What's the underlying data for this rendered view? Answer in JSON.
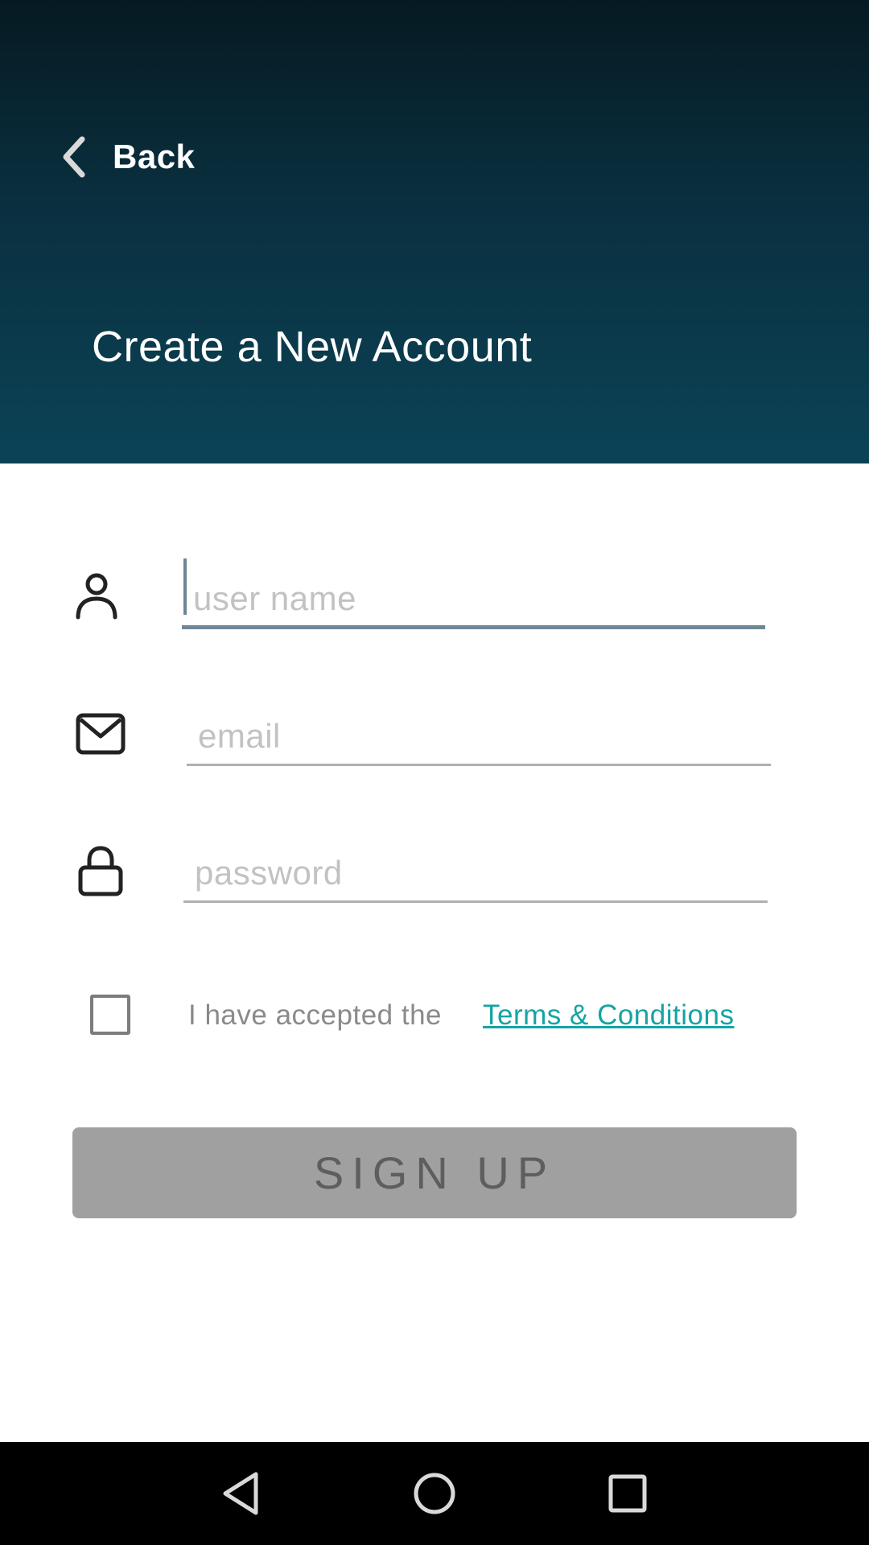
{
  "header": {
    "back_label": "Back",
    "title": "Create a New Account"
  },
  "form": {
    "username": {
      "placeholder": "user name",
      "value": "",
      "icon": "user-icon"
    },
    "email": {
      "placeholder": "email",
      "value": "",
      "icon": "envelope-icon"
    },
    "password": {
      "placeholder": "password",
      "value": "",
      "icon": "lock-icon"
    }
  },
  "terms": {
    "checked": false,
    "text": "I have accepted the",
    "link": "Terms & Conditions"
  },
  "signup_label": "SIGN UP",
  "colors": {
    "header_top": "#061a22",
    "header_bottom": "#0b4356",
    "link": "#16a3a3",
    "button_disabled": "#a0a0a0"
  },
  "navbar": {
    "buttons": [
      "back-nav-icon",
      "home-nav-icon",
      "recents-nav-icon"
    ]
  }
}
